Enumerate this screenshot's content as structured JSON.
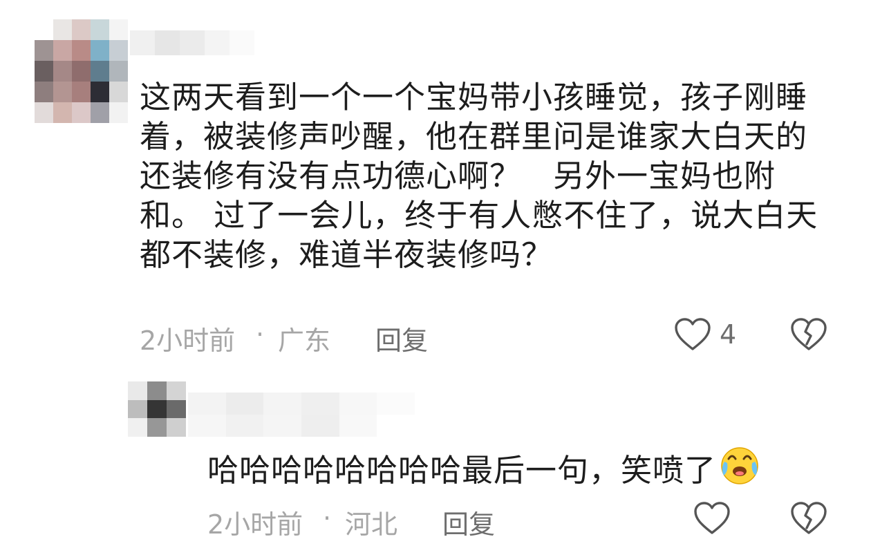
{
  "comments": [
    {
      "text": "这两天看到一个一个宝妈带小孩睡觉，孩子刚睡着，被装修声吵醒，他在群里问是谁家大白天的还装修有没有点功德心啊？　另外一宝妈也附和。 过了一会儿，终于有人憋不住了，说大白天都不装修，难道半夜装修吗？",
      "time": "2小时前",
      "separator": "·",
      "location": "广东",
      "reply_label": "回复",
      "like_count": "4",
      "like_icon": "heart-outline-icon",
      "dislike_icon": "broken-heart-icon"
    },
    {
      "text": "哈哈哈哈哈哈哈哈最后一句，笑喷了",
      "emoji": "laughing-crying-emoji",
      "time": "2小时前",
      "separator": "·",
      "location": "河北",
      "reply_label": "回复",
      "like_icon": "heart-outline-icon",
      "dislike_icon": "broken-heart-icon"
    }
  ]
}
